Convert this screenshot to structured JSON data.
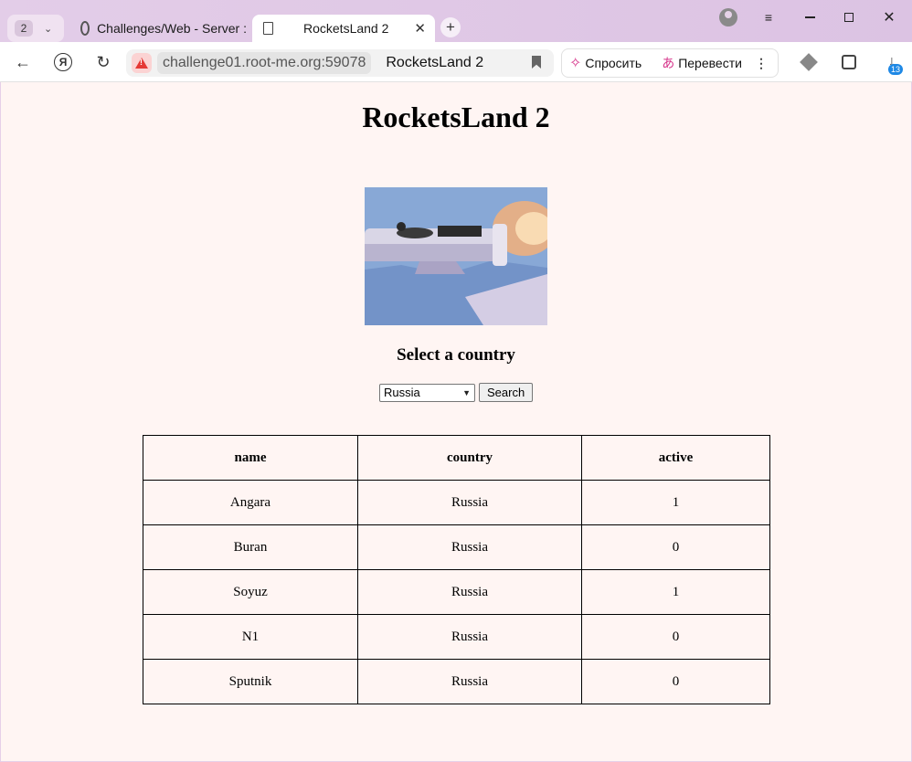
{
  "browser": {
    "tab_count": "2",
    "tabs": [
      {
        "label": "Challenges/Web - Server :"
      },
      {
        "label": "RocketsLand 2"
      }
    ],
    "address": {
      "host": "challenge01.root-me.org:59078",
      "page_title": "RocketsLand 2"
    },
    "toolbar": {
      "ask_label": "Спросить",
      "translate_label": "Перевести",
      "downloads_badge": "13"
    }
  },
  "page": {
    "title": "RocketsLand 2",
    "subtitle": "Select a country",
    "select_value": "Russia",
    "search_label": "Search",
    "table": {
      "headers": [
        "name",
        "country",
        "active"
      ],
      "rows": [
        [
          "Angara",
          "Russia",
          "1"
        ],
        [
          "Buran",
          "Russia",
          "0"
        ],
        [
          "Soyuz",
          "Russia",
          "1"
        ],
        [
          "N1",
          "Russia",
          "0"
        ],
        [
          "Sputnik",
          "Russia",
          "0"
        ]
      ]
    }
  }
}
